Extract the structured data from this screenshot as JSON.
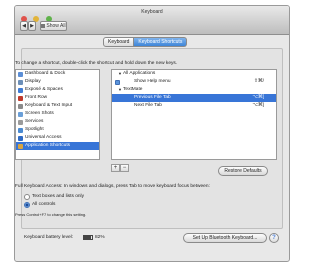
{
  "window": {
    "title": "Keyboard"
  },
  "toolbar": {
    "show_all": "Show All",
    "back": "◀",
    "forward": "▶"
  },
  "tabs": [
    {
      "label": "Keyboard",
      "selected": false
    },
    {
      "label": "Keyboard Shortcuts",
      "selected": true
    }
  ],
  "instructions": "To change a shortcut, double-click the shortcut and hold down the new keys.",
  "categories": [
    {
      "label": "Dashboard & Dock",
      "icon": "dock-icon",
      "color": "#5b8ed6"
    },
    {
      "label": "Display",
      "icon": "display-icon",
      "color": "#6c8fb8"
    },
    {
      "label": "Exposé & Spaces",
      "icon": "spaces-icon",
      "color": "#3f7bd4"
    },
    {
      "label": "Front Row",
      "icon": "front-row-icon",
      "color": "#c0392b"
    },
    {
      "label": "Keyboard & Text Input",
      "icon": "keyboard-icon",
      "color": "#8a8a8a"
    },
    {
      "label": "Screen Shots",
      "icon": "screenshot-icon",
      "color": "#6a9fd8"
    },
    {
      "label": "Services",
      "icon": "services-icon",
      "color": "#9b9b9b"
    },
    {
      "label": "Spotlight",
      "icon": "spotlight-icon",
      "color": "#4a8ad1"
    },
    {
      "label": "Universal Access",
      "icon": "universal-access-icon",
      "color": "#2f6bc5"
    },
    {
      "label": "Application Shortcuts",
      "icon": "app-shortcuts-icon",
      "color": "#d9a441",
      "selected": true
    }
  ],
  "shortcuts": [
    {
      "name": "All Applications",
      "key": "",
      "level": 0,
      "expand": true,
      "checkbox": false,
      "selected": false
    },
    {
      "name": "Show Help menu",
      "key": "⇧⌘/",
      "level": 1,
      "expand": false,
      "checkbox": true,
      "checked": true,
      "selected": false
    },
    {
      "name": "TextMate",
      "key": "",
      "level": 0,
      "expand": true,
      "checkbox": false,
      "selected": false
    },
    {
      "name": "Previous File Tab",
      "key": "⌥⌘[",
      "level": 1,
      "expand": false,
      "checkbox": false,
      "selected": true
    },
    {
      "name": "Next File Tab",
      "key": "⌥⌘]",
      "level": 1,
      "expand": false,
      "checkbox": false,
      "selected": false
    }
  ],
  "buttons": {
    "add": "+",
    "remove": "−",
    "restore_defaults": "Restore Defaults",
    "setup_bluetooth": "Set Up Bluetooth Keyboard...",
    "help": "?"
  },
  "full_access": {
    "heading": "Full Keyboard Access: In windows and dialogs, press Tab to move keyboard focus between:",
    "options": [
      {
        "label": "Text boxes and lists only",
        "selected": false
      },
      {
        "label": "All controls",
        "selected": true
      }
    ],
    "hint": "Press Control+F7 to change this setting."
  },
  "battery": {
    "label": "Keyboard battery level:",
    "level_percent": 82,
    "display": "82%"
  },
  "colors": {
    "selection": "#3875d7",
    "accent": "#3e85d8"
  }
}
